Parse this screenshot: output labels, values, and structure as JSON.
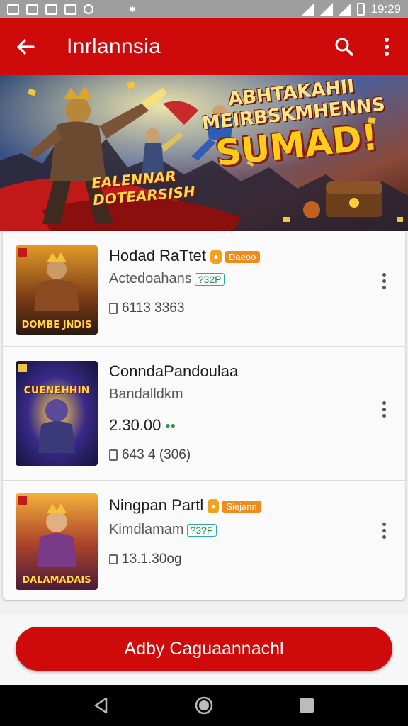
{
  "status_bar": {
    "time": "19:29"
  },
  "app_bar": {
    "title": "Inrlannsia",
    "back_icon": "arrow-left-icon",
    "search_icon": "search-icon",
    "more_icon": "more-vert-icon"
  },
  "hero": {
    "headline_1": "ABHTAKAHII",
    "headline_2": "MEIRBSKMHENNS",
    "headline_3": "SUMAD!",
    "sub_1": "EALENNAR",
    "sub_2": "DOTEARSISH"
  },
  "items": [
    {
      "title": "Hodad RaTtet",
      "tag": "Daeoo",
      "subtitle": "Actedoahans",
      "sub_badge": "?32P",
      "meta": "6113 3363",
      "cover_text": "DOMBE JNDIS"
    },
    {
      "title": "ConndaPandoulaa",
      "subtitle": "Bandalldkm",
      "price": "2.30.00",
      "meta": "643 4 (306)",
      "cover_text": "CUENEHHIN"
    },
    {
      "title": "Ningpan Partl",
      "tag": "Siejann",
      "subtitle": "Kimdlamam",
      "sub_badge": "?3?F",
      "meta": "13.1.30og",
      "cover_text": "DALAMADAIS"
    }
  ],
  "cta": {
    "label": "Adby Caguaannachl"
  },
  "colors": {
    "primary": "#cf0a0a",
    "accent_orange": "#f08a1a",
    "accent_green": "#1d8f4f"
  }
}
